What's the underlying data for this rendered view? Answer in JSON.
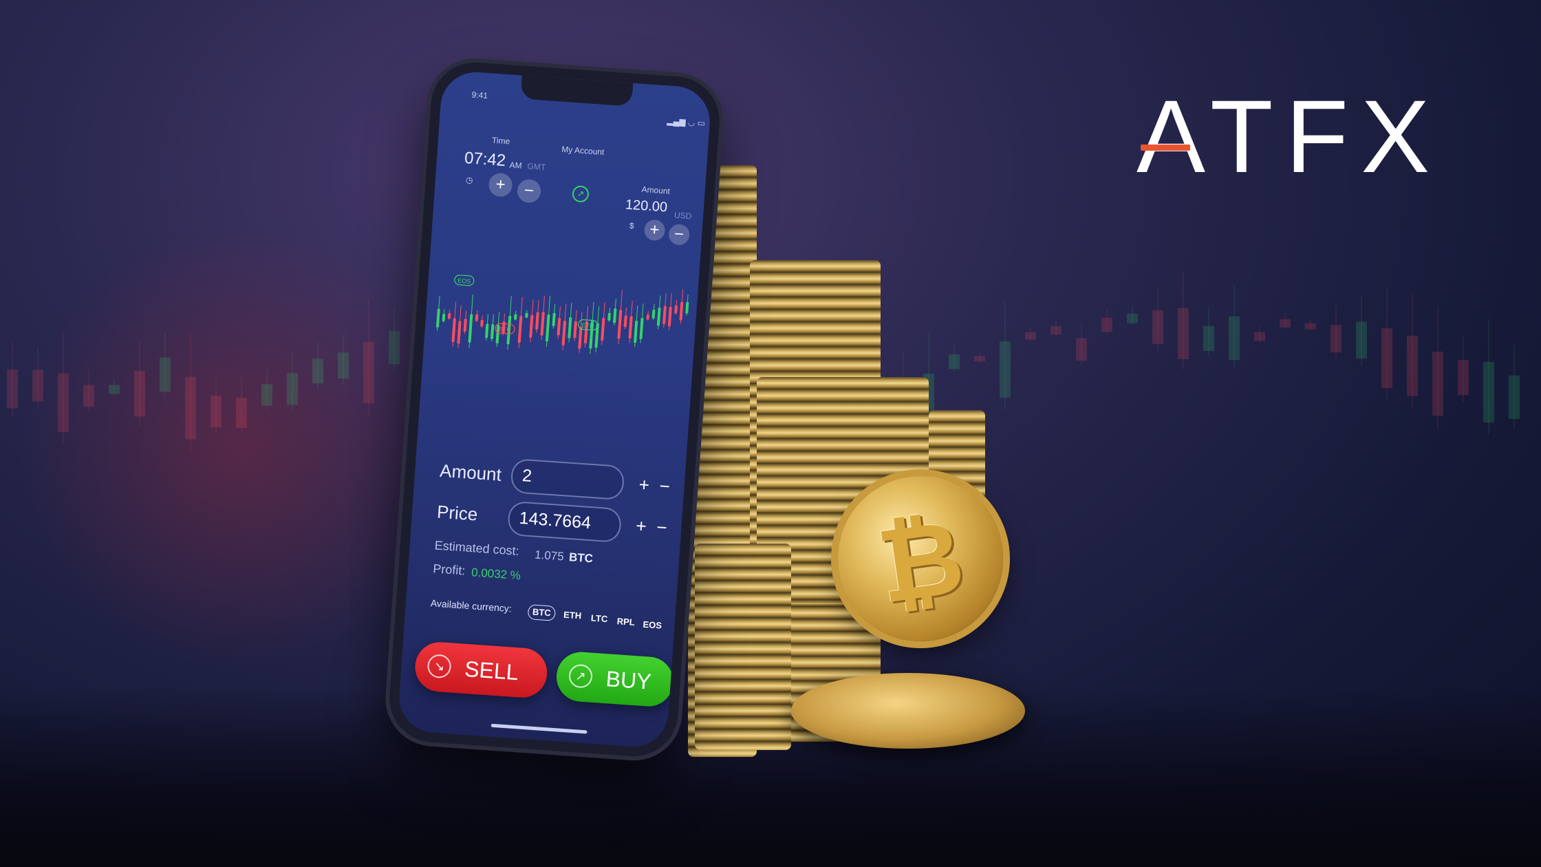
{
  "brand": {
    "logo_text": "ATFX",
    "accent_color": "#e8552f"
  },
  "phone": {
    "status_time": "9:41",
    "header": {
      "time_label": "Time",
      "account_label": "My Account",
      "clock_time": "07:42",
      "ampm": "AM",
      "timezone": "GMT"
    },
    "amount_widget": {
      "label": "Amount",
      "value": "120.00",
      "currency": "USD",
      "symbol": "$"
    },
    "chart_labels": {
      "eos": "EOS",
      "btc": "BTC",
      "eth": "ETH"
    },
    "form": {
      "amount_label": "Amount",
      "amount_value": "2",
      "price_label": "Price",
      "price_value": "143.7664",
      "estimated_cost_label": "Estimated cost:",
      "estimated_cost_value": "1.075",
      "estimated_cost_currency": "BTC",
      "profit_label": "Profit:",
      "profit_value": "0.0032 %"
    },
    "currencies": {
      "label": "Available currency:",
      "items": [
        "BTC",
        "ETH",
        "LTC",
        "RPL",
        "EOS"
      ],
      "selected": "BTC"
    },
    "buttons": {
      "sell": "SELL",
      "buy": "BUY",
      "sell_color": "#e0242b",
      "buy_color": "#34c021"
    }
  },
  "icons": {
    "plus": "+",
    "minus": "−",
    "sell_arrow": "↘",
    "buy_arrow": "↗",
    "clock": "◷"
  },
  "colors": {
    "up": "#35d36a",
    "down": "#ff4d5e"
  }
}
